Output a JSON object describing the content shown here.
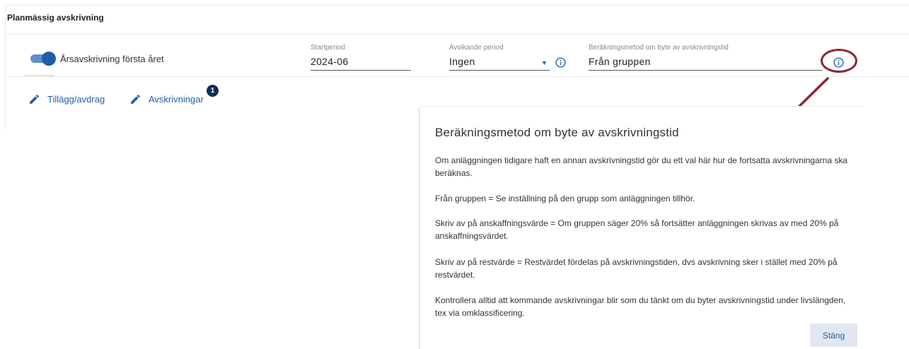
{
  "section": {
    "title": "Planmässig avskrivning"
  },
  "toggle": {
    "label": "Årsavskrivning första året",
    "checked": true
  },
  "fields": {
    "startperiod": {
      "label": "Startperiod",
      "value": "2024-06"
    },
    "avvikande": {
      "label": "Avvikande period",
      "value": "Ingen"
    },
    "berakningsmetod": {
      "label": "Beräkningsmetod om byte av avskrivningstid",
      "value": "Från gruppen"
    }
  },
  "actions": [
    {
      "label": "Tillägg/avdrag",
      "icon": "pencil-icon"
    },
    {
      "label": "Avskrivningar",
      "icon": "pencil-icon",
      "badge": "1"
    }
  ],
  "dialog": {
    "title": "Beräkningsmetod om byte av avskrivningstid",
    "paragraphs": [
      "Om anläggningen tidigare haft en annan avskrivningstid gör du ett val här hur de fortsatta avskrivningarna ska beräknas.",
      "Från gruppen = Se inställning på den grupp som anläggningen tillhör.",
      "Skriv av på anskaffningsvärde = Om gruppen säger 20% så fortsätter anläggningen skrivas av med 20% på anskaffningsvärdet.",
      "Skriv av på restvärde = Restvärdet fördelas på avskrivningstiden, dvs avskrivning sker i stället med 20% på restvärdet.",
      "Kontrollera alltid att kommande avskrivningar blir som du tänkt om du byter avskrivningstid under livslängden, tex via omklassificering."
    ],
    "close_label": "Stäng"
  },
  "colors": {
    "accent": "#1d5ea8",
    "annotation": "#8b2634",
    "badge": "#0f2e55"
  }
}
